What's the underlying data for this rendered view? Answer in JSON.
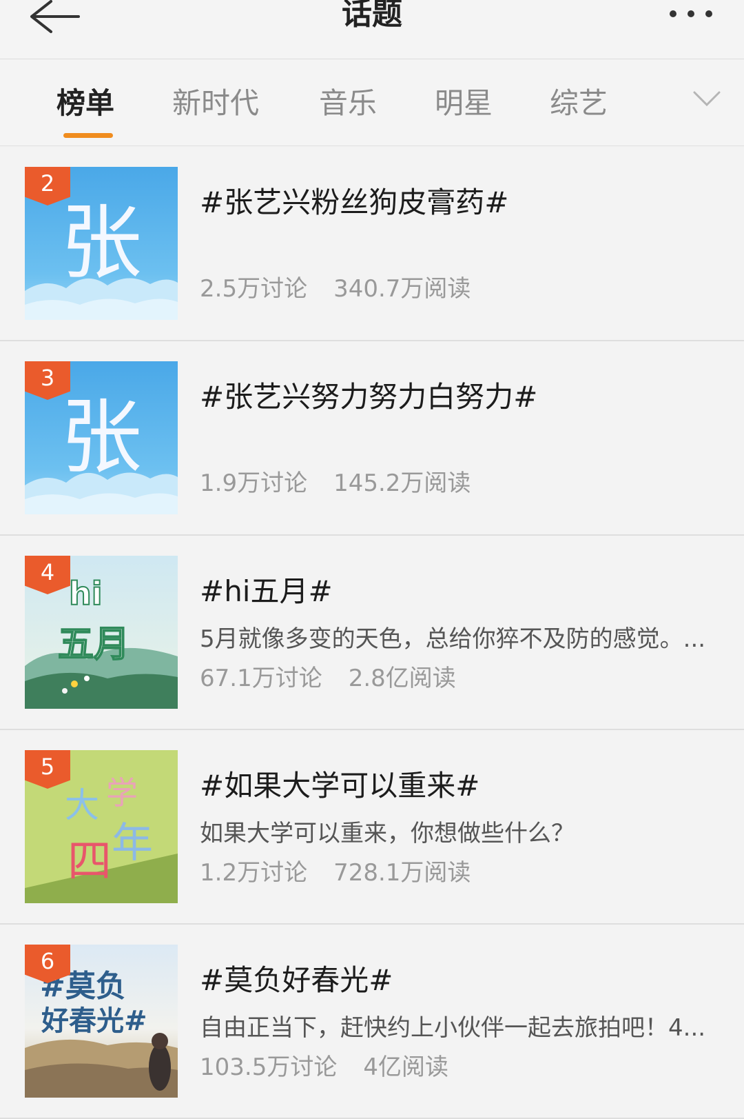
{
  "header": {
    "title": "话题"
  },
  "tabs": [
    {
      "label": "榜单",
      "active": true
    },
    {
      "label": "新时代",
      "active": false
    },
    {
      "label": "音乐",
      "active": false
    },
    {
      "label": "明星",
      "active": false
    },
    {
      "label": "综艺",
      "active": false
    }
  ],
  "colors": {
    "accent": "#f08c1e",
    "rank_badge": "#ea5b2c"
  },
  "topics": [
    {
      "rank": "2",
      "thumb_char": "张",
      "title": "#张艺兴粉丝狗皮膏药#",
      "desc": "",
      "discussions": "2.5万讨论",
      "reads": "340.7万阅读"
    },
    {
      "rank": "3",
      "thumb_char": "张",
      "title": "#张艺兴努力努力白努力#",
      "desc": "",
      "discussions": "1.9万讨论",
      "reads": "145.2万阅读"
    },
    {
      "rank": "4",
      "thumb_text": [
        "hi",
        "五月"
      ],
      "title": "#hi五月#",
      "desc": "5月就像多变的天色，总给你猝不及防的感觉。...",
      "discussions": "67.1万讨论",
      "reads": "2.8亿阅读"
    },
    {
      "rank": "5",
      "thumb_text": [
        "大",
        "学",
        "四",
        "年"
      ],
      "title": "#如果大学可以重来#",
      "desc": "如果大学可以重来，你想做些什么？",
      "discussions": "1.2万讨论",
      "reads": "728.1万阅读"
    },
    {
      "rank": "6",
      "thumb_text": [
        "#莫负",
        "好春光#"
      ],
      "title": "#莫负好春光#",
      "desc": "自由正当下，赶快约上小伙伴一起去旅拍吧！4...",
      "discussions": "103.5万讨论",
      "reads": "4亿阅读"
    }
  ]
}
